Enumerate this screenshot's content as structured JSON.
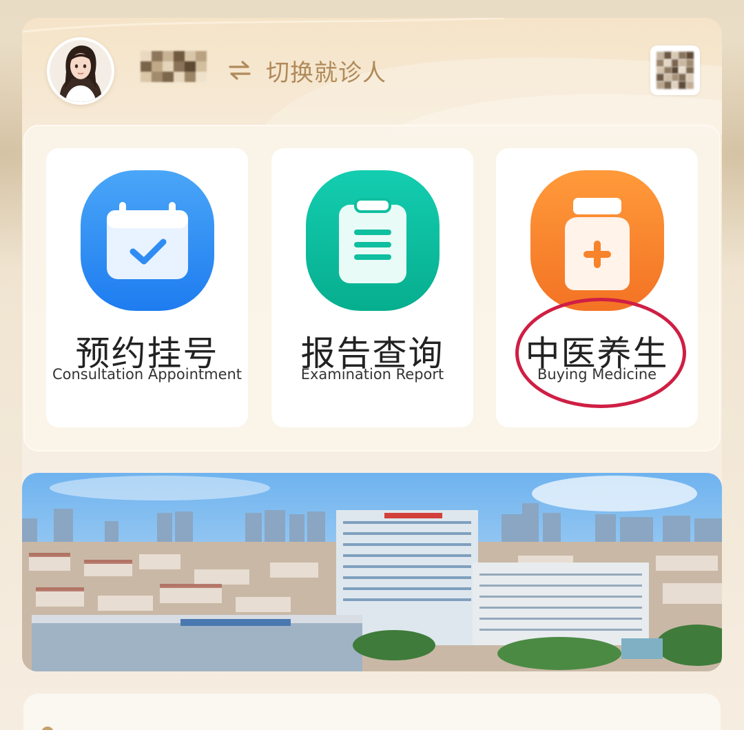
{
  "header": {
    "patient_name": "",
    "switch_label": "切换就诊人"
  },
  "services": [
    {
      "title": "预约挂号",
      "subtitle": "Consultation Appointment",
      "icon": "calendar-check-icon",
      "color": "#2f8cf3"
    },
    {
      "title": "报告查询",
      "subtitle": "Examination Report",
      "icon": "clipboard-icon",
      "color": "#0fbf9f"
    },
    {
      "title": "中医养生",
      "subtitle": "Buying Medicine",
      "icon": "medicine-bottle-icon",
      "color": "#f7832b"
    }
  ],
  "colors": {
    "accent_gold": "#b08a5a",
    "highlight_ring": "#cf1f44"
  }
}
